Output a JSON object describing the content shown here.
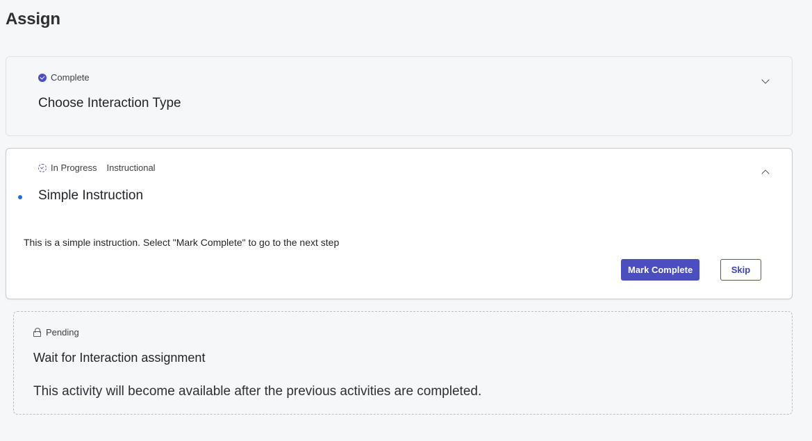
{
  "page": {
    "title": "Assign"
  },
  "steps": [
    {
      "status": "Complete",
      "status_icon": "check-circle-icon",
      "title": "Choose Interaction Type",
      "expanded": false
    },
    {
      "status": "In Progress",
      "status_icon": "in-progress-icon",
      "tag": "Instructional",
      "title": "Simple Instruction",
      "expanded": true,
      "description": "This is a simple instruction. Select \"Mark Complete\" to go to the next step",
      "primary_action": "Mark Complete",
      "secondary_action": "Skip"
    },
    {
      "status": "Pending",
      "status_icon": "lock-icon",
      "title": "Wait for Interaction assignment",
      "description": "This activity will become available after the previous activities are completed."
    }
  ],
  "colors": {
    "accent": "#4a4ec0",
    "current_dot": "#1b6fd8",
    "background": "#f6f7f8"
  }
}
